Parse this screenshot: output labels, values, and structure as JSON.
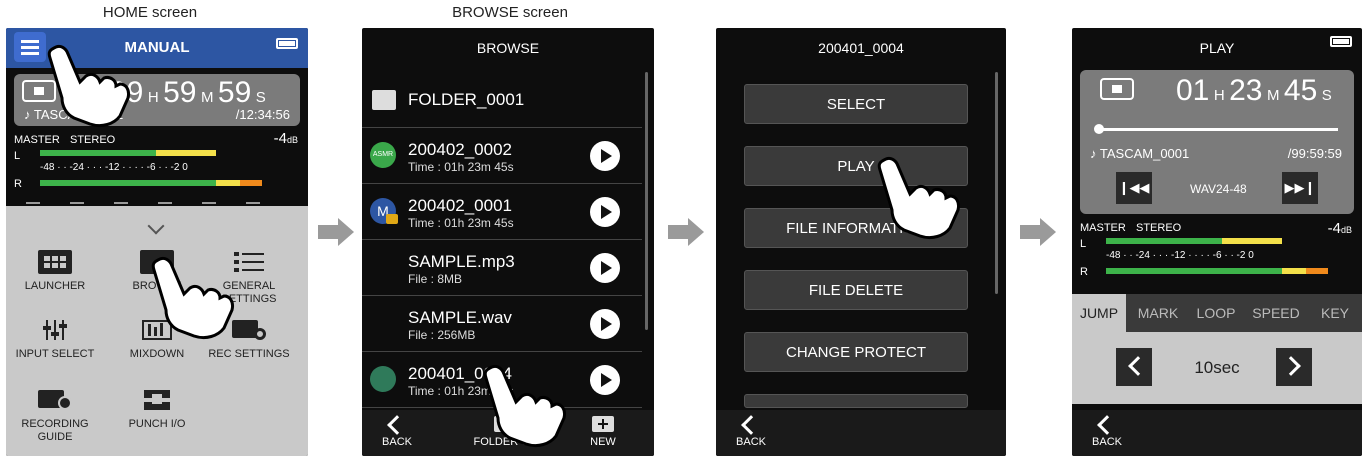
{
  "captions": {
    "home": "HOME screen",
    "browse": "BROWSE screen"
  },
  "home": {
    "title": "MANUAL",
    "time_h": "99",
    "unit_h": "H",
    "time_m": "59",
    "unit_m": "M",
    "time_s": "59",
    "unit_s": "S",
    "file": "♪ TASCAM_0001",
    "remain": "/12:34:56",
    "master": "MASTER",
    "stereo": "STEREO",
    "level": "-4",
    "level_unit": "dB",
    "ch_l": "L",
    "ch_r": "R",
    "scale": "-48 · · -24 · · · -12 · · · · -6 · · -2 0",
    "apps": [
      {
        "label": "LAUNCHER"
      },
      {
        "label": "BROWSE"
      },
      {
        "label": "GENERAL SETTINGS"
      },
      {
        "label": "INPUT SELECT"
      },
      {
        "label": "MIXDOWN"
      },
      {
        "label": "REC SETTINGS"
      },
      {
        "label": "RECORDING GUIDE"
      },
      {
        "label": "PUNCH I/O"
      }
    ]
  },
  "browse": {
    "title": "BROWSE",
    "rows": [
      {
        "name": "FOLDER_0001",
        "sub": ""
      },
      {
        "name": "200402_0002",
        "sub": "Time : 01h 23m 45s",
        "badge": "ASMR"
      },
      {
        "name": "200402_0001",
        "sub": "Time : 01h 23m 45s",
        "badge": "M"
      },
      {
        "name": "SAMPLE.mp3",
        "sub": "File : 8MB"
      },
      {
        "name": "SAMPLE.wav",
        "sub": "File : 256MB"
      },
      {
        "name": "200401_0004",
        "sub": "Time : 01h 23m 45s"
      }
    ],
    "footer": {
      "back": "BACK",
      "folder_up": "FOLDER UP",
      "new": "NEW"
    }
  },
  "menu": {
    "title": "200401_0004",
    "buttons": [
      "SELECT",
      "PLAY",
      "FILE INFORMATION",
      "FILE DELETE",
      "CHANGE PROTECT"
    ],
    "back": "BACK"
  },
  "play": {
    "title": "PLAY",
    "time_h": "01",
    "unit_h": "H",
    "time_m": "23",
    "unit_m": "M",
    "time_s": "45",
    "unit_s": "S",
    "file": "♪ TASCAM_0001",
    "remain": "/99:59:59",
    "format": "WAV24-48",
    "master": "MASTER",
    "stereo": "STEREO",
    "level": "-4",
    "level_unit": "dB",
    "ch_l": "L",
    "ch_r": "R",
    "scale": "-48 · · -24 · · · -12 · · · · -6 · · -2 0",
    "tabs": [
      "JUMP",
      "MARK",
      "LOOP",
      "SPEED",
      "KEY"
    ],
    "jump_value": "10sec",
    "back": "BACK"
  },
  "colors": {
    "header_blue": "#2d56a3",
    "meter_green": "#3db34a",
    "meter_yellow": "#f3e04a",
    "meter_orange": "#f08a1c",
    "panel_grey": "#7b7b7b"
  }
}
